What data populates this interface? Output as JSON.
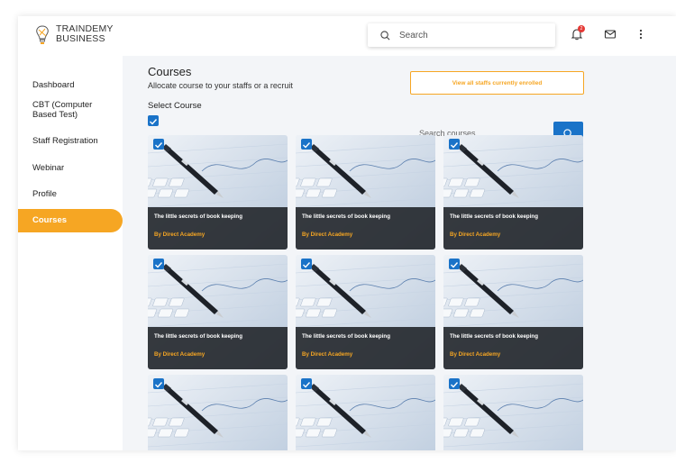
{
  "header": {
    "brand_line1": "TRAINDEMY",
    "brand_line2": "BUSINESS",
    "search_placeholder": "Search",
    "notification_count": "2"
  },
  "sidebar": {
    "items": [
      {
        "label": "Dashboard"
      },
      {
        "label": "CBT (Computer Based Test)"
      },
      {
        "label": "Staff Registration"
      },
      {
        "label": "Webinar"
      },
      {
        "label": "Profile"
      },
      {
        "label": "Courses",
        "active": true
      }
    ]
  },
  "main": {
    "title": "Courses",
    "subtitle": "Allocate course to your staffs or a recruit",
    "select_label": "Select Course",
    "view_button": "View all staffs currently enrolled",
    "course_search_placeholder": "Search courses",
    "courses": [
      {
        "title": "The little secrets of book keeping",
        "author": "By Direct Academy",
        "checked": true
      },
      {
        "title": "The little secrets of book keeping",
        "author": "By Direct Academy",
        "checked": true
      },
      {
        "title": "The little secrets of book keeping",
        "author": "By Direct Academy",
        "checked": true
      },
      {
        "title": "The little secrets of book keeping",
        "author": "By Direct Academy",
        "checked": true
      },
      {
        "title": "The little secrets of book keeping",
        "author": "By Direct Academy",
        "checked": true
      },
      {
        "title": "The little secrets of book keeping",
        "author": "By Direct Academy",
        "checked": true
      },
      {
        "title": "",
        "author": "",
        "checked": true
      },
      {
        "title": "",
        "author": "",
        "checked": true
      },
      {
        "title": "",
        "author": "",
        "checked": true
      }
    ]
  },
  "colors": {
    "accent": "#f6a623",
    "primary": "#1a73c8",
    "badge": "#e53935"
  },
  "icons": [
    "bulb-logo-icon",
    "search-icon",
    "bell-icon",
    "mail-icon",
    "more-vert-icon",
    "checkbox-icon"
  ]
}
